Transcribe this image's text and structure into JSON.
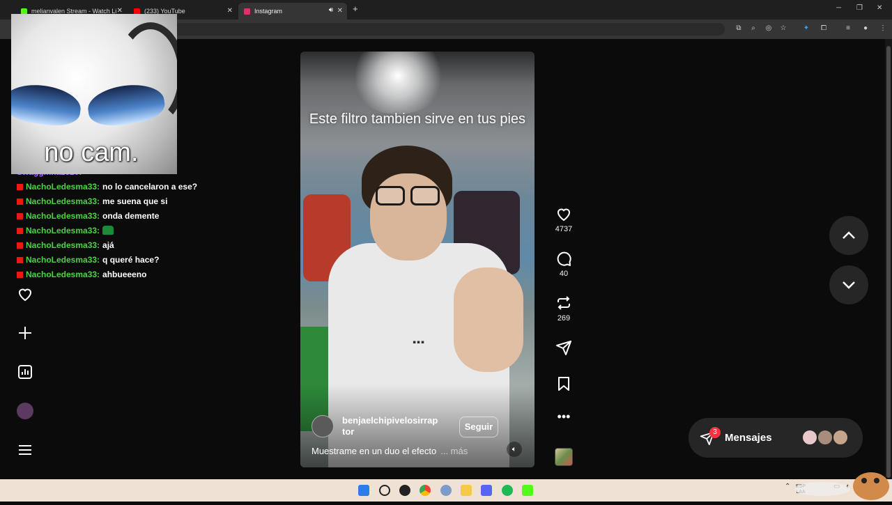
{
  "browser": {
    "tabs": [
      {
        "title": "melianvalen Stream - Watch Li",
        "favicon_color": "#53fc18"
      },
      {
        "title": "(233) YouTube",
        "favicon_color": "#ff0000"
      },
      {
        "title": "Instagram",
        "favicon_color": "#e1306c"
      }
    ],
    "url_fragment": "/"
  },
  "webcam_overlay": {
    "text": "no cam."
  },
  "chat": {
    "partial_user": "Swaggmnaze20:",
    "messages": [
      {
        "user": "NachoLedesma33:",
        "text": "no lo cancelaron a ese?"
      },
      {
        "user": "NachoLedesma33:",
        "text": "me suena que si"
      },
      {
        "user": "NachoLedesma33:",
        "text": "onda demente"
      },
      {
        "user": "NachoLedesma33:",
        "text": ""
      },
      {
        "user": "NachoLedesma33:",
        "text": "ajá"
      },
      {
        "user": "NachoLedesma33:",
        "text": "q queré hace?"
      },
      {
        "user": "NachoLedesma33:",
        "text": "ahbueeeno"
      }
    ]
  },
  "reel": {
    "overlay_text": "Este filtro tambien sirve en tus pies",
    "username": "benjaelchipivelosirraptor",
    "follow_label": "Seguir",
    "description": "Muestrame en un duo el efecto",
    "more_label": "... más",
    "likes": "4737",
    "comments": "40",
    "reposts": "269"
  },
  "messages": {
    "label": "Mensajes",
    "badge_count": "3"
  },
  "system_tray": {
    "lang": "ESP",
    "region": "LAA"
  },
  "colors": {
    "accent_red": "#ff3040",
    "chat_user": "#4dd246",
    "chat_user_alt": "#b166ff"
  }
}
